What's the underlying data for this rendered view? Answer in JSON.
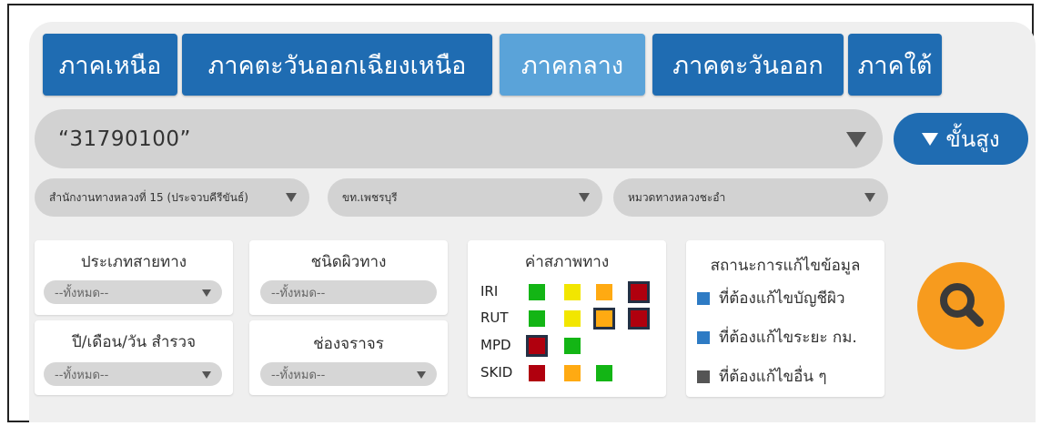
{
  "regions": [
    {
      "label": "ภาคเหนือ",
      "active": false
    },
    {
      "label": "ภาคตะวันออกเฉียงเหนือ",
      "active": false
    },
    {
      "label": "ภาคกลาง",
      "active": true
    },
    {
      "label": "ภาคตะวันออก",
      "active": false
    },
    {
      "label": "ภาคใต้",
      "active": false
    }
  ],
  "search": {
    "value": "“31790100”"
  },
  "advanced": {
    "label": "ขั้นสูง"
  },
  "filters": {
    "office": "สำนักงานทางหลวงที่ 15 (ประจวบคีรีขันธ์)",
    "district": "ขท.เพชรบุรี",
    "unit": "หมวดทางหลวงชะอำ"
  },
  "road_type": {
    "title": "ประเภทสายทาง",
    "value": "--ทั้งหมด--"
  },
  "surface_type": {
    "title": "ชนิดผิวทาง",
    "value": "--ทั้งหมด--"
  },
  "survey_date": {
    "title": "ปี/เดือน/วัน สำรวจ",
    "value": "--ทั้งหมด--"
  },
  "lane": {
    "title": "ช่องจราจร",
    "value": "--ทั้งหมด--"
  },
  "condition": {
    "title": "ค่าสภาพทาง",
    "rows": [
      {
        "label": "IRI",
        "squares": [
          "green",
          "yellow",
          "orange",
          "red"
        ],
        "selected": [
          3
        ]
      },
      {
        "label": "RUT",
        "squares": [
          "green",
          "yellow",
          "orange",
          "red"
        ],
        "selected": [
          2,
          3
        ]
      },
      {
        "label": "MPD",
        "squares": [
          "red",
          "green"
        ],
        "selected": [
          0
        ]
      },
      {
        "label": "SKID",
        "squares": [
          "red",
          "orange",
          "green"
        ],
        "selected": []
      }
    ]
  },
  "status": {
    "title": "สถานะการแก้ไขข้อมูล",
    "items": [
      {
        "label": "ที่ต้องแก้ไขบัญชีผิว",
        "color": "#2e7bc4"
      },
      {
        "label": "ที่ต้องแก้ไขระยะ กม.",
        "color": "#2e7bc4"
      },
      {
        "label": "ที่ต้องแก้ไขอื่น ๆ",
        "color": "#555555"
      }
    ]
  },
  "colors": {
    "primary": "#1f6cb2",
    "primary_active": "#5aa3d9",
    "search_button": "#f79b1e",
    "green": "#13b515",
    "yellow": "#f2e600",
    "orange": "#ffaa12",
    "red": "#b0000e"
  },
  "icons": {
    "search": "magnifier-icon",
    "advanced": "triangle-down-icon"
  }
}
